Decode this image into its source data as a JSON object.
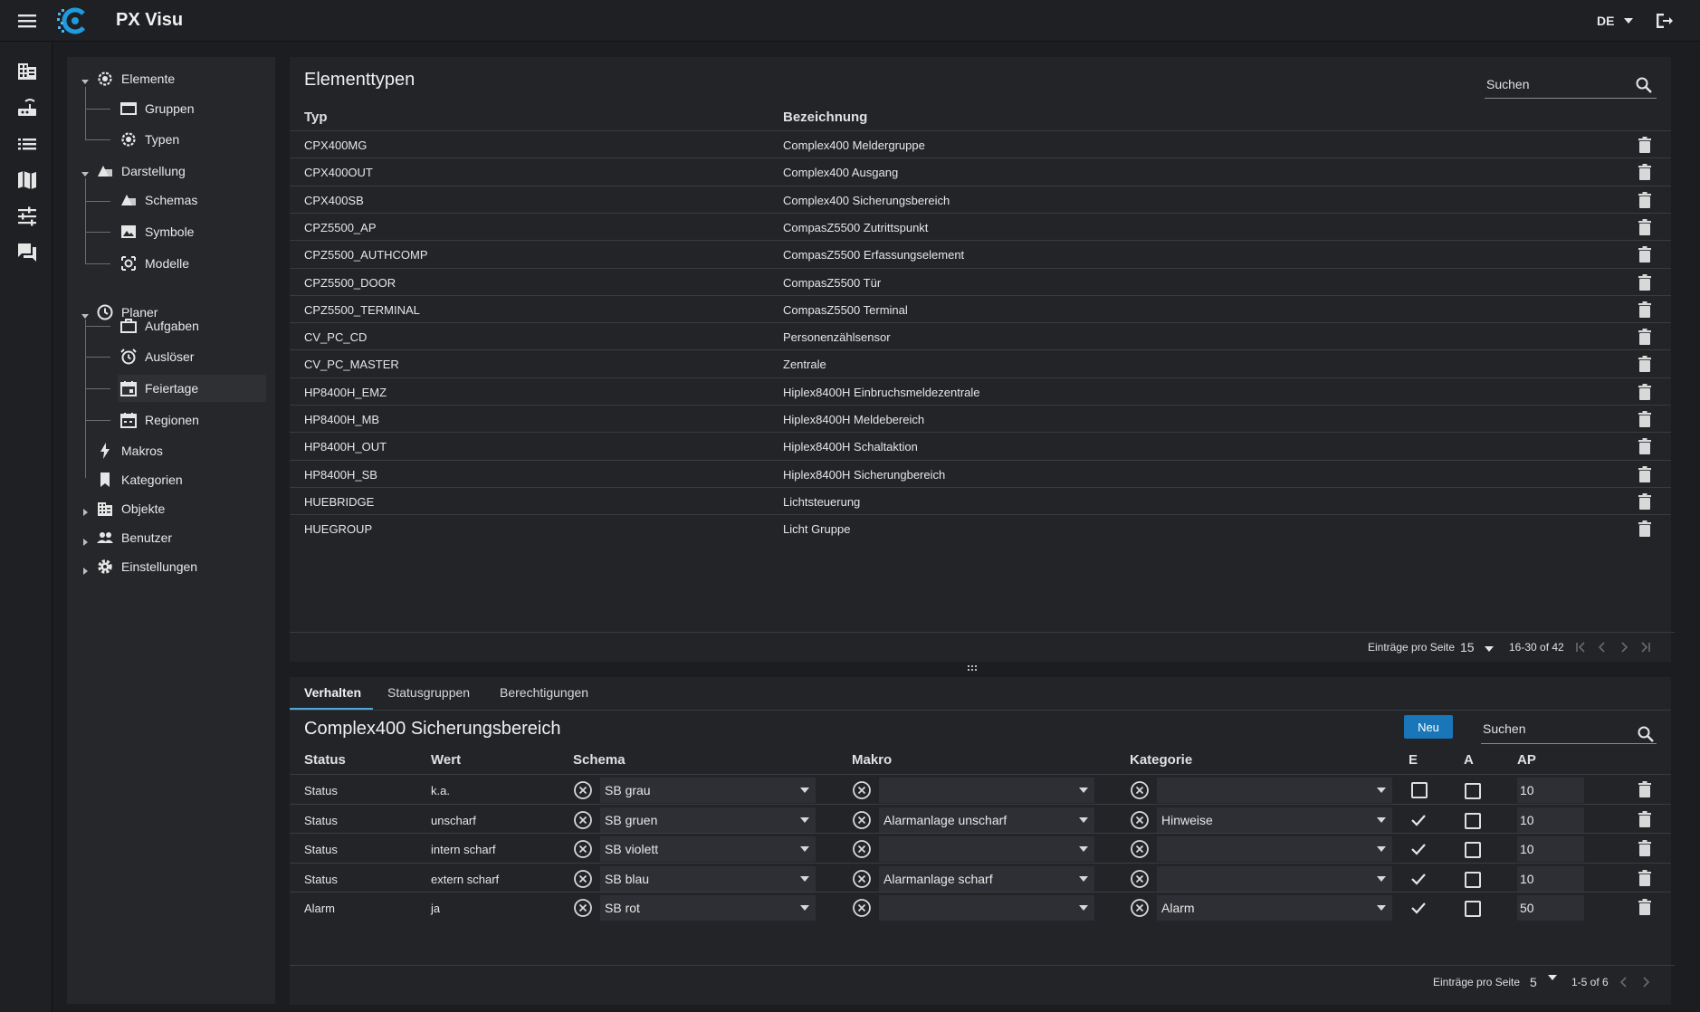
{
  "app": {
    "title": "PX Visu",
    "language": "DE"
  },
  "tree": {
    "items": [
      {
        "label": "Elemente",
        "icon": "gear-chip-icon"
      },
      {
        "label": "Gruppen",
        "icon": "folder-icon"
      },
      {
        "label": "Typen",
        "icon": "gear-chip-icon"
      },
      {
        "label": "Darstellung",
        "icon": "shapes-icon"
      },
      {
        "label": "Schemas",
        "icon": "shapes-icon"
      },
      {
        "label": "Symbole",
        "icon": "image-icon"
      },
      {
        "label": "Modelle",
        "icon": "model-icon"
      },
      {
        "label": "Planer",
        "icon": "clock-icon"
      },
      {
        "label": "Aufgaben",
        "icon": "briefcase-icon"
      },
      {
        "label": "Auslöser",
        "icon": "alarm-clock-icon"
      },
      {
        "label": "Feiertage",
        "icon": "calendar-icon"
      },
      {
        "label": "Regionen",
        "icon": "calendar-icon"
      },
      {
        "label": "Makros",
        "icon": "lightning-icon"
      },
      {
        "label": "Kategorien",
        "icon": "bookmark-icon"
      },
      {
        "label": "Objekte",
        "icon": "building-icon"
      },
      {
        "label": "Benutzer",
        "icon": "users-icon"
      },
      {
        "label": "Einstellungen",
        "icon": "gear-icon"
      }
    ]
  },
  "types": {
    "title": "Elementtypen",
    "search_placeholder": "Suchen",
    "columns": {
      "type": "Typ",
      "name": "Bezeichnung"
    },
    "rows": [
      {
        "type": "CPX400MG",
        "name": "Complex400 Meldergruppe"
      },
      {
        "type": "CPX400OUT",
        "name": "Complex400 Ausgang"
      },
      {
        "type": "CPX400SB",
        "name": "Complex400 Sicherungsbereich"
      },
      {
        "type": "CPZ5500_AP",
        "name": "CompasZ5500 Zutrittspunkt"
      },
      {
        "type": "CPZ5500_AUTHCOMP",
        "name": "CompasZ5500 Erfassungselement"
      },
      {
        "type": "CPZ5500_DOOR",
        "name": "CompasZ5500 Tür"
      },
      {
        "type": "CPZ5500_TERMINAL",
        "name": "CompasZ5500 Terminal"
      },
      {
        "type": "CV_PC_CD",
        "name": "Personenzählsensor"
      },
      {
        "type": "CV_PC_MASTER",
        "name": "Zentrale"
      },
      {
        "type": "HP8400H_EMZ",
        "name": "Hiplex8400H Einbruchsmeldezentrale"
      },
      {
        "type": "HP8400H_MB",
        "name": "Hiplex8400H Meldebereich"
      },
      {
        "type": "HP8400H_OUT",
        "name": "Hiplex8400H Schaltaktion"
      },
      {
        "type": "HP8400H_SB",
        "name": "Hiplex8400H Sicherungbereich"
      },
      {
        "type": "HUEBRIDGE",
        "name": "Lichtsteuerung"
      },
      {
        "type": "HUEGROUP",
        "name": "Licht Gruppe"
      }
    ],
    "footer": {
      "per_page_label": "Einträge pro Seite",
      "per_page": "15",
      "range": "16-30 of 42"
    }
  },
  "detail": {
    "tabs": [
      "Verhalten",
      "Statusgruppen",
      "Berechtigungen"
    ],
    "title": "Complex400 Sicherungsbereich",
    "new_button": "Neu",
    "search_placeholder": "Suchen",
    "columns": {
      "status": "Status",
      "value": "Wert",
      "schema": "Schema",
      "macro": "Makro",
      "category": "Kategorie",
      "e": "E",
      "a": "A",
      "ap": "AP"
    },
    "rows": [
      {
        "status": "Status",
        "value": "k.a.",
        "schema": "SB grau",
        "macro": "",
        "category": "",
        "e": false,
        "a": false,
        "ap": "10"
      },
      {
        "status": "Status",
        "value": "unscharf",
        "schema": "SB gruen",
        "macro": "Alarmanlage unscharf",
        "category": "Hinweise",
        "e": true,
        "a": false,
        "ap": "10"
      },
      {
        "status": "Status",
        "value": "intern scharf",
        "schema": "SB violett",
        "macro": "",
        "category": "",
        "e": true,
        "a": false,
        "ap": "10"
      },
      {
        "status": "Status",
        "value": "extern scharf",
        "schema": "SB blau",
        "macro": "Alarmanlage scharf",
        "category": "",
        "e": true,
        "a": false,
        "ap": "10"
      },
      {
        "status": "Alarm",
        "value": "ja",
        "schema": "SB rot",
        "macro": "",
        "category": "Alarm",
        "e": true,
        "a": false,
        "ap": "50"
      }
    ],
    "footer": {
      "per_page_label": "Einträge pro Seite",
      "per_page": "5",
      "range": "1-5 of 6"
    }
  },
  "colors": {
    "accent": "#1976b8",
    "background": "#1c1d20",
    "panel": "#232428"
  }
}
